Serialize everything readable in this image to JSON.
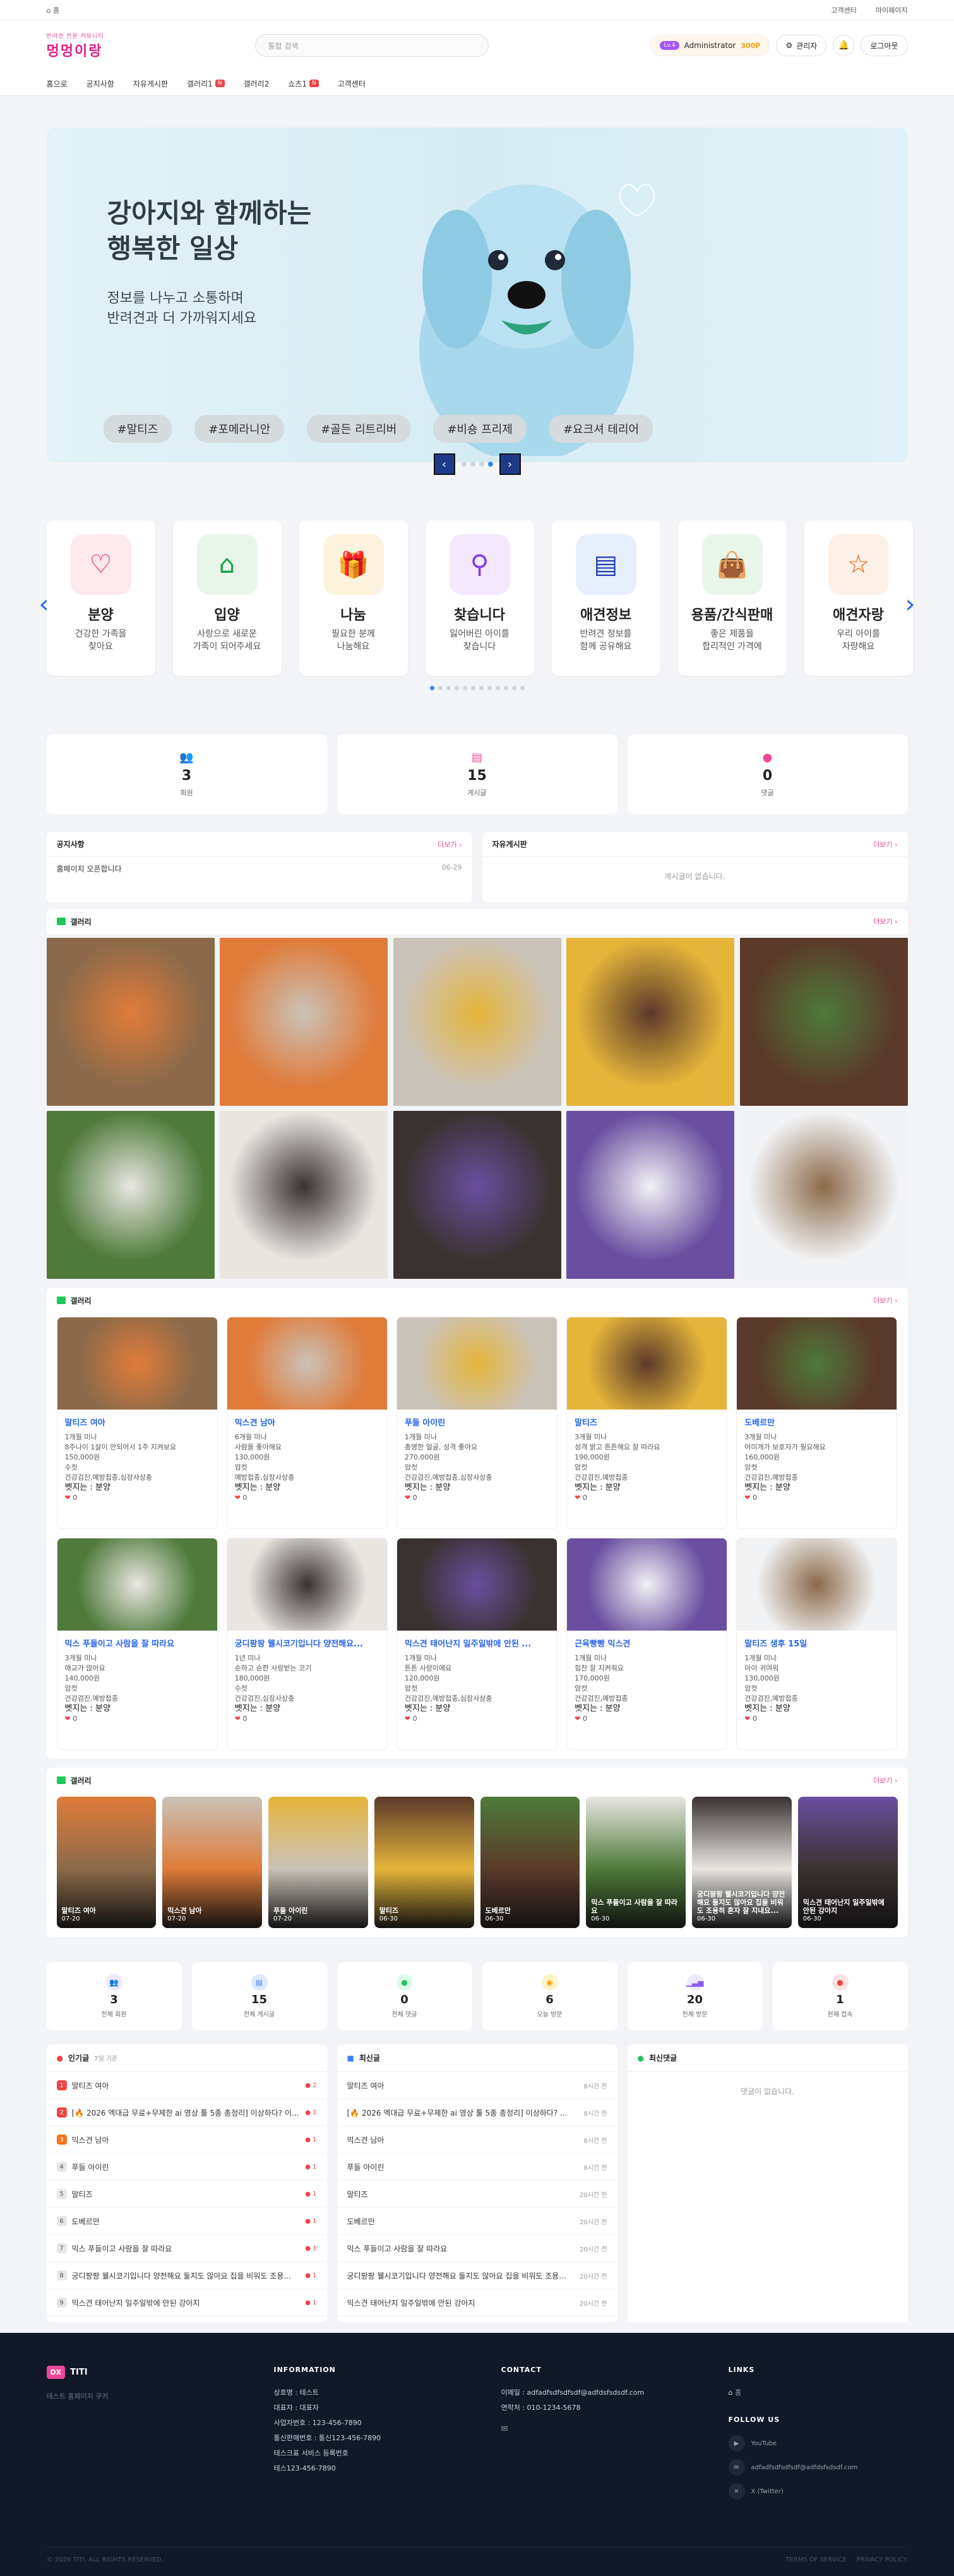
{
  "topbar": {
    "home": "홈",
    "links": [
      "고객센터",
      "마이페이지"
    ]
  },
  "logo": {
    "sub": "반려견 전문 커뮤니티",
    "main": "멍멍이랑"
  },
  "search": {
    "placeholder": "통합 검색"
  },
  "user": {
    "level": "Lv.4",
    "name": "Administrator",
    "points": "300P",
    "admin": "관리자",
    "logout": "로그아웃"
  },
  "nav": [
    {
      "label": "홈으로",
      "badge": ""
    },
    {
      "label": "공지사항",
      "badge": ""
    },
    {
      "label": "자유게시판",
      "badge": ""
    },
    {
      "label": "갤러리1",
      "badge": "N"
    },
    {
      "label": "갤러리2",
      "badge": ""
    },
    {
      "label": "쇼츠1",
      "badge": "N"
    },
    {
      "label": "고객센터",
      "badge": ""
    }
  ],
  "hero": {
    "title1": "강아지와 함께하는",
    "title2": "행복한 일상",
    "sub1": "정보를 나누고 소통하며",
    "sub2": "반려견과 더 가까워지세요",
    "tags": [
      "#말티즈",
      "#포메라니안",
      "#골든 리트리버",
      "#비숑 프리제",
      "#요크셔 테리어"
    ]
  },
  "categories": [
    {
      "title": "분양",
      "d1": "건강한 가족을",
      "d2": "찾아요",
      "icon": "heart-house-icon",
      "bg": "#fde8ec",
      "fg": "#e11d48"
    },
    {
      "title": "입양",
      "d1": "사랑으로 새로운",
      "d2": "가족이 되어주세요",
      "icon": "home-icon",
      "bg": "#e8f5e9",
      "fg": "#16a34a"
    },
    {
      "title": "나눔",
      "d1": "필요한 분께",
      "d2": "나눔해요",
      "icon": "gift-icon",
      "bg": "#fdf2dc",
      "fg": "#d97706"
    },
    {
      "title": "찾습니다",
      "d1": "잃어버린 아이를",
      "d2": "찾습니다",
      "icon": "search-icon",
      "bg": "#f3e8fd",
      "fg": "#7c3aed"
    },
    {
      "title": "애견정보",
      "d1": "반려견 정보를",
      "d2": "함께 공유해요",
      "icon": "document-icon",
      "bg": "#e7eefc",
      "fg": "#1e40af"
    },
    {
      "title": "용품/간식판매",
      "d1": "좋은 제품을",
      "d2": "합리적인 가격에",
      "icon": "bag-icon",
      "bg": "#e8f5e9",
      "fg": "#15803d"
    },
    {
      "title": "애견자랑",
      "d1": "우리 아이를",
      "d2": "자랑해요",
      "icon": "star-badge-icon",
      "bg": "#fdf0e6",
      "fg": "#ea580c"
    }
  ],
  "stats": [
    {
      "value": "3",
      "label": "회원",
      "color": "#a855f7",
      "icon": "users-icon"
    },
    {
      "value": "15",
      "label": "게시글",
      "color": "#ec4899",
      "icon": "file-icon"
    },
    {
      "value": "0",
      "label": "댓글",
      "color": "#ec4899",
      "icon": "comment-icon"
    }
  ],
  "notice": {
    "title": "공지사항",
    "more": "더보기 ›",
    "items": [
      {
        "text": "홈페이지 오픈합니다",
        "time": "06-29"
      }
    ]
  },
  "free": {
    "title": "자유게시판",
    "more": "더보기 ›",
    "empty": "게시글이 없습니다."
  },
  "gallery1": {
    "title": "갤러리",
    "more": "더보기 ›"
  },
  "gallery2": {
    "title": "갤러리",
    "more": "더보기 ›",
    "cards": [
      {
        "title": "말티즈 여아",
        "l1": "1개월 미나",
        "l2": "8주나이 1살이 안되어서 1주 지켜보요",
        "l3": "150,000원",
        "l4": "수컷",
        "l5": "건강검진,예방접종,심장사상충",
        "owner": "벳지는 : 분양",
        "likes": "0"
      },
      {
        "title": "믹스견 남아",
        "l1": "6개월 미나",
        "l2": "사람을 좋아해요",
        "l3": "130,000원",
        "l4": "암컷",
        "l5": "예방접종,심장사상충",
        "owner": "벳지는 : 분양",
        "likes": "0"
      },
      {
        "title": "푸들 아이린",
        "l1": "1개월 미나",
        "l2": "총명한 얼굴, 성격 좋아요",
        "l3": "270,000원",
        "l4": "암컷",
        "l5": "건강검진,예방접종,심장사상충",
        "owner": "벳지는 : 분양",
        "likes": "0"
      },
      {
        "title": "말티즈",
        "l1": "3개월 미나",
        "l2": "성격 밝고 튼튼해요 잘 따라요",
        "l3": "190,000원",
        "l4": "암컷",
        "l5": "건강검진,예방접종",
        "owner": "벳지는 : 분양",
        "likes": "0"
      },
      {
        "title": "도베르만",
        "l1": "3개월 미나",
        "l2": "어미개가 보호자가 필요해요",
        "l3": "160,000원",
        "l4": "암컷",
        "l5": "건강검진,예방접종",
        "owner": "벳지는 : 분양",
        "likes": "0"
      },
      {
        "title": "믹스 푸들이고 사람을 잘 따라요",
        "l1": "3개월 미나",
        "l2": "애교가 많아요",
        "l3": "140,000원",
        "l4": "암컷",
        "l5": "건강검진,예방접종",
        "owner": "벳지는 : 분양",
        "likes": "0"
      },
      {
        "title": "궁디팡팡 웰시코기입니다 양전해요...",
        "l1": "1년 미나",
        "l2": "순하고 순한 사랑받는 코기",
        "l3": "180,000원",
        "l4": "수컷",
        "l5": "건강검진,심장사상충",
        "owner": "벳지는 : 분양",
        "likes": "0"
      },
      {
        "title": "믹스견 태어난지 일주일밖에 안된 ...",
        "l1": "1개월 미나",
        "l2": "튼튼 사랑이에요",
        "l3": "120,000원",
        "l4": "암컷",
        "l5": "건강검진,예방접종,심장사상충",
        "owner": "벳지는 : 분양",
        "likes": "0"
      },
      {
        "title": "근육빵빵 믹스견",
        "l1": "1개월 미나",
        "l2": "힘찬 잘 지켜줘요",
        "l3": "170,000원",
        "l4": "암컷",
        "l5": "건강검진,예방접종",
        "owner": "벳지는 : 분양",
        "likes": "0"
      },
      {
        "title": "말티즈 생후 15일",
        "l1": "1개월 미나",
        "l2": "아이 귀여워",
        "l3": "130,000원",
        "l4": "암컷",
        "l5": "건강검진,예방접종",
        "owner": "벳지는 : 분양",
        "likes": "0"
      }
    ]
  },
  "gallery3": {
    "title": "갤러리",
    "more": "더보기 ›",
    "items": [
      {
        "title": "말티즈 여아",
        "time": "07-20"
      },
      {
        "title": "믹스견 남아",
        "time": "07-20"
      },
      {
        "title": "푸들 아이린",
        "time": "07-20"
      },
      {
        "title": "말티즈",
        "time": "06-30"
      },
      {
        "title": "도베르만",
        "time": "06-30"
      },
      {
        "title": "믹스 푸들이고 사람을 잘 따라요",
        "time": "06-30"
      },
      {
        "title": "궁디팡팡 웰시코기입니다 양전해요 둘지도 않아요 집을 비워도 조용히 혼자 잘 지내요...",
        "time": "06-30"
      },
      {
        "title": "믹스견 태어난지 일주일밖에 안된 강아지",
        "time": "06-30"
      }
    ]
  },
  "stats6": [
    {
      "value": "3",
      "label": "전체 회원",
      "color": "#a855f7",
      "bg": "#f3e8ff",
      "icon": "users-icon"
    },
    {
      "value": "15",
      "label": "전체 게시글",
      "color": "#3b82f6",
      "bg": "#dbeafe",
      "icon": "file-icon"
    },
    {
      "value": "0",
      "label": "전체 댓글",
      "color": "#22c55e",
      "bg": "#dcfce7",
      "icon": "comment-icon"
    },
    {
      "value": "6",
      "label": "오늘 방문",
      "color": "#f59e0b",
      "bg": "#fef3c7",
      "icon": "eye-icon"
    },
    {
      "value": "20",
      "label": "전체 방문",
      "color": "#8b5cf6",
      "bg": "#ede9fe",
      "icon": "chart-icon"
    },
    {
      "value": "1",
      "label": "현재 접속",
      "color": "#ef4444",
      "bg": "#fee2e2",
      "icon": "online-icon"
    }
  ],
  "popular": {
    "title": "인기글",
    "sub": "7일 기준",
    "items": [
      {
        "n": "1",
        "t": "말티즈 여아",
        "c": "2"
      },
      {
        "n": "2",
        "t": "[🔥 2026 엑대급 무료+무제한 ai 영상 툴 5종 총정리] 이상하다? 이...",
        "c": "1"
      },
      {
        "n": "3",
        "t": "믹스견 남아",
        "c": "1"
      },
      {
        "n": "4",
        "t": "푸들 아이린",
        "c": "1"
      },
      {
        "n": "5",
        "t": "말티즈",
        "c": "1"
      },
      {
        "n": "6",
        "t": "도베르만",
        "c": "1"
      },
      {
        "n": "7",
        "t": "믹스 푸들이고 사람을 잘 따라요",
        "c": "1"
      },
      {
        "n": "8",
        "t": "궁디팡팡 웰시코기입니다 양전해요 둘지도 않아요 집을 비워도 조용...",
        "c": "1"
      },
      {
        "n": "9",
        "t": "믹스견 태어난지 일주일밖에 안된 강아지",
        "c": "1"
      }
    ]
  },
  "latest": {
    "title": "최신글",
    "items": [
      {
        "t": "말티즈 여아",
        "tm": "8시간 전"
      },
      {
        "t": "[🔥 2026 엑대급 무료+무제한 ai 영상 툴 5종 총정리] 이상하다? ...",
        "tm": "8시간 전"
      },
      {
        "t": "믹스견 남아",
        "tm": "8시간 전"
      },
      {
        "t": "푸들 아이린",
        "tm": "8시간 전"
      },
      {
        "t": "말티즈",
        "tm": "20시간 전"
      },
      {
        "t": "도베르만",
        "tm": "20시간 전"
      },
      {
        "t": "믹스 푸들이고 사람을 잘 따라요",
        "tm": "20시간 전"
      },
      {
        "t": "궁디팡팡 웰시코기입니다 양전해요 둘지도 않아요 집을 비워도 조용...",
        "tm": "20시간 전"
      },
      {
        "t": "믹스견 태어난지 일주일밖에 안된 강아지",
        "tm": "20시간 전"
      }
    ]
  },
  "comments": {
    "title": "최신댓글",
    "empty": "댓글이 없습니다."
  },
  "footer": {
    "logo_box": "DX",
    "logo_name": "TITI",
    "desc": "테스트 홈페이지 쿠키",
    "info_title": "INFORMATION",
    "info": [
      "상호명 : 테스트",
      "대표자 : 대표자",
      "사업자번호 : 123-456-7890",
      "통신판매번호 : 통신123-456-7890",
      "테스크표 서비스 등록번호",
      "테스123-456-7890"
    ],
    "contact_title": "CONTACT",
    "contact": [
      "이메일 : adfadfsdfsdfsdf@adfdsfsdsdf.com",
      "연락처 : 010-1234-5678"
    ],
    "links_title": "LINKS",
    "links": [
      "홈"
    ],
    "follow_title": "FOLLOW US",
    "follow": [
      "YouTube",
      "adfadfsdfsdfsdf@adfdsfsdsdf.com",
      "X (Twitter)"
    ],
    "copyright": "© 2026 TITI. ALL RIGHTS RESERVED.",
    "terms": "TERMS OF SERVICE",
    "privacy": "PRIVACY POLICY"
  }
}
